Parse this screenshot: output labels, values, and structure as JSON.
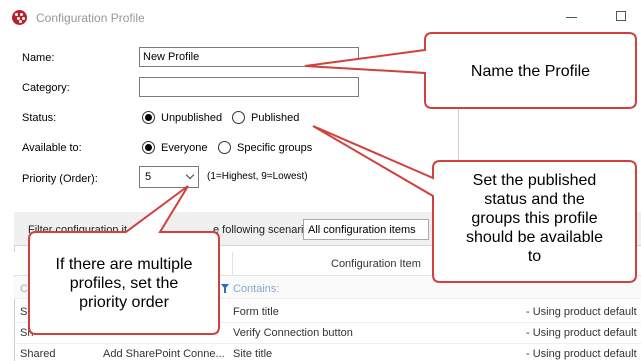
{
  "window": {
    "title": "Configuration Profile"
  },
  "form": {
    "name_label": "Name:",
    "name_value": "New Profile",
    "category_label": "Category:",
    "category_value": "",
    "status_label": "Status:",
    "status_options": [
      "Unpublished",
      "Published"
    ],
    "status_selected": "Unpublished",
    "available_label": "Available to:",
    "available_options": [
      "Everyone",
      "Specific groups"
    ],
    "available_selected": "Everyone",
    "priority_label": "Priority (Order):",
    "priority_value": "5",
    "priority_hint": "(1=Highest, 9=Lowest)"
  },
  "grid": {
    "filter_label_part1": "Filter configuration it",
    "filter_label_part2": "e following scenario:",
    "filter_value": "All configuration items",
    "column_header": "Configuration Item",
    "column_header_right": "e",
    "filter_placeholder": "Contains:",
    "row_stub_c": "C",
    "rows": [
      {
        "scope": "Sh",
        "item": "Form title",
        "value": "- Using product default"
      },
      {
        "scope": "Sh",
        "item": "Verify Connection button",
        "value": "- Using product default"
      },
      {
        "scope": "Shared",
        "category": "Add SharePoint Conne...",
        "item": "Site title",
        "value": "- Using product default"
      }
    ]
  },
  "callouts": {
    "name": "Name the Profile",
    "status": [
      "Set the published",
      "status and the",
      "groups this profile",
      "should be available",
      "to"
    ],
    "priority": [
      "If there are multiple",
      "profiles, set the",
      "priority order"
    ]
  },
  "colors": {
    "callout_border": "#d0413b",
    "callout_fill": "#ffffff",
    "app_icon": "#b8232b"
  }
}
